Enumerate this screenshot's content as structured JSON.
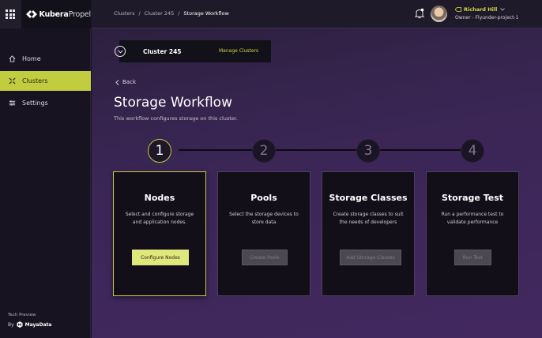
{
  "brand": {
    "name_bold": "Kubera",
    "name_light": "Propel"
  },
  "nav": [
    {
      "label": "Home",
      "icon": "home-icon"
    },
    {
      "label": "Clusters",
      "icon": "clusters-icon",
      "active": true
    },
    {
      "label": "Settings",
      "icon": "settings-icon"
    }
  ],
  "footer": {
    "tech_preview": "Tech Preview",
    "by": "By",
    "maker": "MayaData"
  },
  "breadcrumb": [
    "Clusters",
    "/",
    "Cluster 245",
    "/",
    "Storage Workflow"
  ],
  "user": {
    "name": "Richard Hill",
    "role": "Owner - Flyunder-project-1"
  },
  "cluster": {
    "name": "Cluster 245",
    "manage_label": "Manage Clusters"
  },
  "page": {
    "back_label": "Back",
    "title": "Storage Workflow",
    "subtitle": "This workflow configures storage on this cluster."
  },
  "steps": [
    {
      "number": "1",
      "title": "Nodes",
      "description": "Select and configure storage and application nodes.",
      "button": "Configure Nodes",
      "active": true
    },
    {
      "number": "2",
      "title": "Pools",
      "description": "Select the storage devices to store data",
      "button": "Create Pools",
      "active": false
    },
    {
      "number": "3",
      "title": "Storage Classes",
      "description": "Create storage classes to suit the needs of developers",
      "button": "Add Storage Classes",
      "active": false
    },
    {
      "number": "4",
      "title": "Storage Test",
      "description": "Run a performance test to validate  performance",
      "button": "Run Test",
      "active": false
    }
  ],
  "colors": {
    "accent": "#c2cc3f",
    "accent_light": "#e0e77c",
    "user_name": "#d5d94a"
  }
}
